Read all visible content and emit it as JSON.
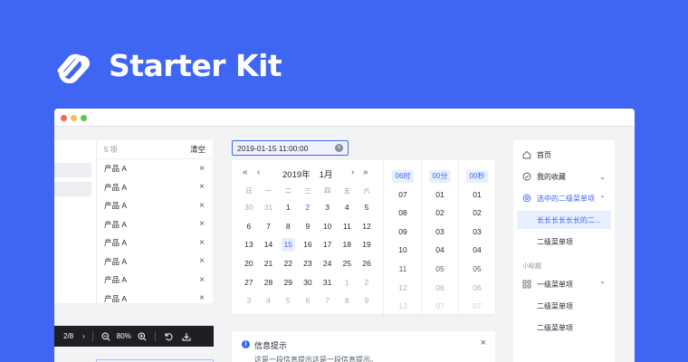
{
  "hero": {
    "title": "Starter Kit",
    "logo_icon": "link-logo-icon"
  },
  "window": {
    "traffic_lights": [
      "#f5665b",
      "#f5bf4f",
      "#5fc453"
    ]
  },
  "transfer": {
    "count_label": "5 项",
    "clear_label": "清空",
    "items": [
      "产品 A",
      "产品 A",
      "产品 A",
      "产品 A",
      "产品 A",
      "产品 A",
      "产品 A",
      "产品 A"
    ]
  },
  "image_toolbar": {
    "page": "2/8",
    "zoom": "80%"
  },
  "datepicker": {
    "value": "2019-01-15  11:00:00",
    "year_label": "2019年",
    "month_label": "1月",
    "weekdays": [
      "日",
      "一",
      "二",
      "三",
      "四",
      "五",
      "六"
    ],
    "days": [
      {
        "d": "30",
        "s": "dim"
      },
      {
        "d": "31",
        "s": "dim"
      },
      {
        "d": "1",
        "s": ""
      },
      {
        "d": "2",
        "s": "today"
      },
      {
        "d": "3",
        "s": ""
      },
      {
        "d": "4",
        "s": ""
      },
      {
        "d": "5",
        "s": ""
      },
      {
        "d": "6",
        "s": ""
      },
      {
        "d": "7",
        "s": ""
      },
      {
        "d": "8",
        "s": ""
      },
      {
        "d": "9",
        "s": ""
      },
      {
        "d": "10",
        "s": ""
      },
      {
        "d": "11",
        "s": ""
      },
      {
        "d": "12",
        "s": ""
      },
      {
        "d": "13",
        "s": ""
      },
      {
        "d": "14",
        "s": ""
      },
      {
        "d": "15",
        "s": "sel"
      },
      {
        "d": "16",
        "s": ""
      },
      {
        "d": "17",
        "s": ""
      },
      {
        "d": "18",
        "s": ""
      },
      {
        "d": "19",
        "s": ""
      },
      {
        "d": "20",
        "s": ""
      },
      {
        "d": "21",
        "s": ""
      },
      {
        "d": "22",
        "s": ""
      },
      {
        "d": "23",
        "s": ""
      },
      {
        "d": "24",
        "s": ""
      },
      {
        "d": "25",
        "s": ""
      },
      {
        "d": "26",
        "s": ""
      },
      {
        "d": "27",
        "s": ""
      },
      {
        "d": "28",
        "s": ""
      },
      {
        "d": "29",
        "s": ""
      },
      {
        "d": "30",
        "s": ""
      },
      {
        "d": "31",
        "s": ""
      },
      {
        "d": "1",
        "s": "dim"
      },
      {
        "d": "2",
        "s": "dim"
      },
      {
        "d": "3",
        "s": "dim"
      },
      {
        "d": "4",
        "s": "dim"
      },
      {
        "d": "5",
        "s": "dim"
      },
      {
        "d": "6",
        "s": "dim"
      },
      {
        "d": "7",
        "s": "dim"
      },
      {
        "d": "8",
        "s": "dim"
      },
      {
        "d": "9",
        "s": "dim"
      }
    ],
    "time_columns": [
      {
        "head": "06时",
        "cells": [
          "07",
          "08",
          "09",
          "10",
          "11",
          "12",
          "13"
        ]
      },
      {
        "head": "00分",
        "cells": [
          "01",
          "02",
          "03",
          "04",
          "05",
          "06",
          "07"
        ]
      },
      {
        "head": "00秒",
        "cells": [
          "01",
          "02",
          "03",
          "04",
          "05",
          "06",
          "07"
        ]
      }
    ]
  },
  "alert": {
    "title": "信息提示",
    "text": "这是一段信息提示这是一段信息提示。"
  },
  "menu": {
    "home": "首页",
    "favorites": "我的收藏",
    "selected_submenu": "选中的二级菜单项",
    "long_item": "长长长长长长的二...",
    "sub_item": "二级菜单项",
    "group_title": "小标题",
    "level1": "一级菜单项",
    "sub_item_2": "二级菜单项",
    "sub_item_3": "二级菜单项"
  }
}
